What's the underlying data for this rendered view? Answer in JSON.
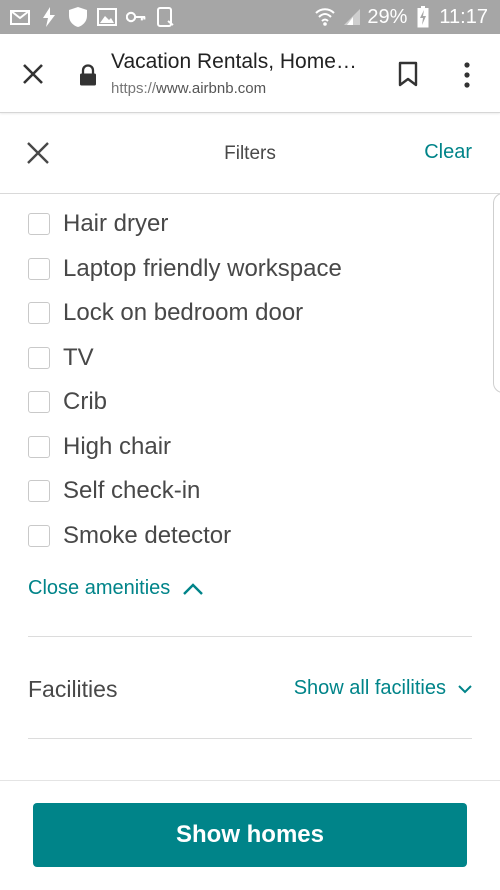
{
  "status_bar": {
    "battery": "29%",
    "time": "11:17"
  },
  "browser": {
    "title": "Vacation Rentals, Home…",
    "url_scheme": "https://",
    "url_host": "www.airbnb.com"
  },
  "filters": {
    "title": "Filters",
    "clear_label": "Clear"
  },
  "amenities": {
    "items": [
      {
        "label": "Hair dryer",
        "checked": false
      },
      {
        "label": "Laptop friendly workspace",
        "checked": false
      },
      {
        "label": "Lock on bedroom door",
        "checked": false
      },
      {
        "label": "TV",
        "checked": false
      },
      {
        "label": "Crib",
        "checked": false
      },
      {
        "label": "High chair",
        "checked": false
      },
      {
        "label": "Self check-in",
        "checked": false
      },
      {
        "label": "Smoke detector",
        "checked": false
      }
    ],
    "close_label": "Close amenities"
  },
  "facilities": {
    "label": "Facilities",
    "show_all_label": "Show all facilities"
  },
  "footer": {
    "show_homes_label": "Show homes"
  },
  "colors": {
    "accent": "#008489",
    "status_bar": "#a6a6a6"
  }
}
